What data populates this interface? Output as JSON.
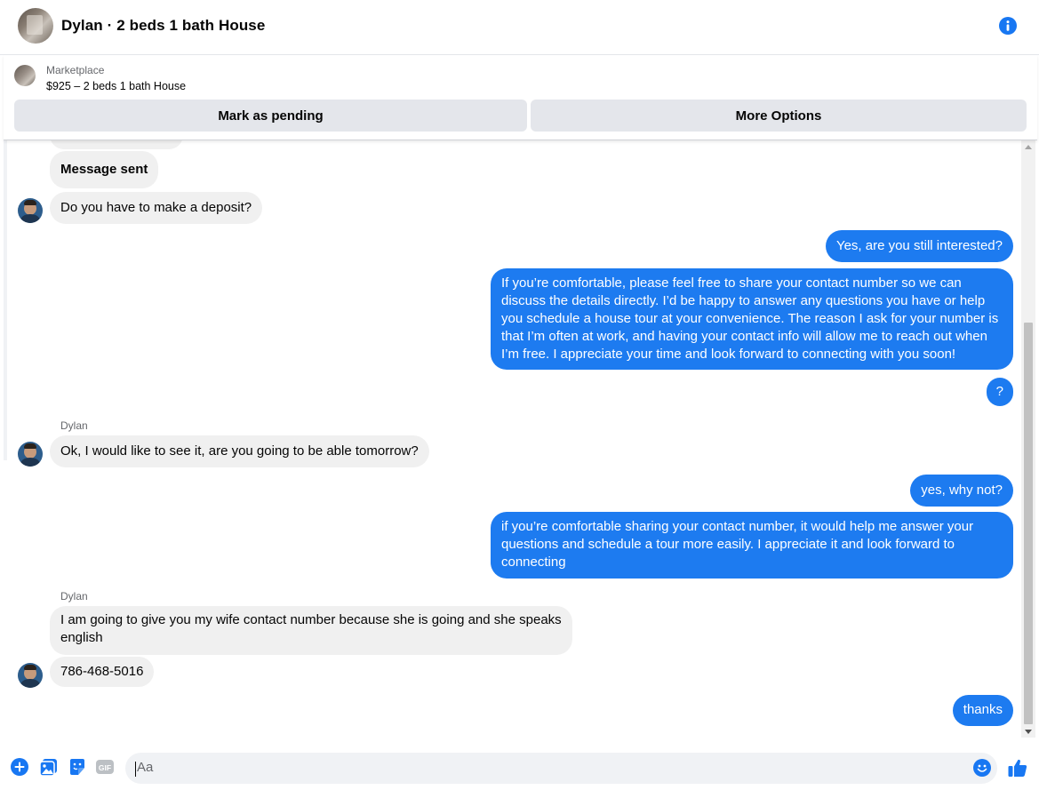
{
  "header": {
    "title": "Dylan · 2 beds 1 bath House",
    "info_icon": "info-icon",
    "accent_color": "#1877f2"
  },
  "marketplace": {
    "label": "Marketplace",
    "listing": "$925 – 2 beds 1 bath House",
    "buttons": {
      "pending": "Mark as pending",
      "more": "More Options"
    }
  },
  "messages": [
    {
      "from": "them",
      "text": "Message sent",
      "bold": true
    },
    {
      "from": "them",
      "text": "Do you have to make a deposit?"
    },
    {
      "from": "me",
      "text": "Yes, are you still interested?"
    },
    {
      "from": "me",
      "text": "If you’re comfortable, please feel free to share your contact number so we can discuss the details directly. I’d be happy to answer any questions you have or help you schedule a house tour at your convenience. The reason I ask for your number is that I’m often at work, and having your contact info will allow me to reach out when I’m free. I appreciate your time and look forward to connecting with you soon!"
    },
    {
      "from": "me",
      "text": "?"
    },
    {
      "from": "them",
      "sender": "Dylan",
      "text": "Ok, I would like to see it, are you going to be able tomorrow?"
    },
    {
      "from": "me",
      "text": "yes, why not?"
    },
    {
      "from": "me",
      "text": "if you’re comfortable sharing your contact number, it would help me answer your questions and schedule a tour more easily. I appreciate it and look forward to connecting"
    },
    {
      "from": "them",
      "sender": "Dylan",
      "text": "I am going to give you my wife contact number because she is going and she speaks english"
    },
    {
      "from": "them",
      "text": "786-468-5016"
    },
    {
      "from": "me",
      "text": "thanks"
    }
  ],
  "composer": {
    "placeholder": "Aa",
    "icons": [
      "add-icon",
      "photo-icon",
      "sticker-icon",
      "gif-icon",
      "emoji-icon",
      "thumbs-up-icon"
    ],
    "gif_label": "GIF"
  },
  "colors": {
    "outgoing_bubble": "#1d7bf0",
    "incoming_bubble": "#f0f0f0"
  }
}
